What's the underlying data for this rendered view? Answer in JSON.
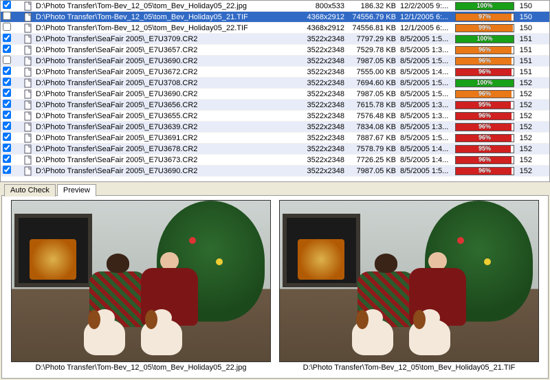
{
  "rows": [
    {
      "checked": true,
      "name": "D:\\Photo Transfer\\Tom-Bev_12_05\\tom_Bev_Holiday05_22.jpg",
      "dim": "800x533",
      "size": "186.32 KB",
      "date": "12/2/2005 9:...",
      "pct": 100,
      "color": "#18a018",
      "grp": "150",
      "alt": false,
      "sel": false
    },
    {
      "checked": false,
      "name": "D:\\Photo Transfer\\Tom-Bev_12_05\\tom_Bev_Holiday05_21.TIF",
      "dim": "4368x2912",
      "size": "74556.79 KB",
      "date": "12/1/2005 6:...",
      "pct": 97,
      "color": "#e87818",
      "grp": "150",
      "alt": true,
      "sel": true
    },
    {
      "checked": false,
      "name": "D:\\Photo Transfer\\Tom-Bev_12_05\\tom_Bev_Holiday05_22.TIF",
      "dim": "4368x2912",
      "size": "74556.81 KB",
      "date": "12/1/2005 6:...",
      "pct": 99,
      "color": "#e87818",
      "grp": "150",
      "alt": false,
      "sel": false
    },
    {
      "checked": true,
      "name": "D:\\Photo Transfer\\SeaFair 2005\\_E7U3709.CR2",
      "dim": "3522x2348",
      "size": "7797.29 KB",
      "date": "8/5/2005 1:5...",
      "pct": 100,
      "color": "#18a018",
      "grp": "151",
      "alt": true,
      "sel": false
    },
    {
      "checked": true,
      "name": "D:\\Photo Transfer\\SeaFair 2005\\_E7U3657.CR2",
      "dim": "3522x2348",
      "size": "7529.78 KB",
      "date": "8/5/2005 1:3...",
      "pct": 96,
      "color": "#e87818",
      "grp": "151",
      "alt": false,
      "sel": false
    },
    {
      "checked": false,
      "name": "D:\\Photo Transfer\\SeaFair 2005\\_E7U3690.CR2",
      "dim": "3522x2348",
      "size": "7987.05 KB",
      "date": "8/5/2005 1:5...",
      "pct": 96,
      "color": "#e87818",
      "grp": "151",
      "alt": true,
      "sel": false
    },
    {
      "checked": true,
      "name": "D:\\Photo Transfer\\SeaFair 2005\\_E7U3672.CR2",
      "dim": "3522x2348",
      "size": "7555.00 KB",
      "date": "8/5/2005 1:4...",
      "pct": 96,
      "color": "#d02020",
      "grp": "151",
      "alt": false,
      "sel": false
    },
    {
      "checked": true,
      "name": "D:\\Photo Transfer\\SeaFair 2005\\_E7U3708.CR2",
      "dim": "3522x2348",
      "size": "7694.60 KB",
      "date": "8/5/2005 1:5...",
      "pct": 100,
      "color": "#18a018",
      "grp": "152",
      "alt": true,
      "sel": false
    },
    {
      "checked": true,
      "name": "D:\\Photo Transfer\\SeaFair 2005\\_E7U3690.CR2",
      "dim": "3522x2348",
      "size": "7987.05 KB",
      "date": "8/5/2005 1:5...",
      "pct": 96,
      "color": "#e87818",
      "grp": "152",
      "alt": false,
      "sel": false
    },
    {
      "checked": true,
      "name": "D:\\Photo Transfer\\SeaFair 2005\\_E7U3656.CR2",
      "dim": "3522x2348",
      "size": "7615.78 KB",
      "date": "8/5/2005 1:3...",
      "pct": 95,
      "color": "#d02020",
      "grp": "152",
      "alt": true,
      "sel": false
    },
    {
      "checked": true,
      "name": "D:\\Photo Transfer\\SeaFair 2005\\_E7U3655.CR2",
      "dim": "3522x2348",
      "size": "7576.48 KB",
      "date": "8/5/2005 1:3...",
      "pct": 96,
      "color": "#d02020",
      "grp": "152",
      "alt": false,
      "sel": false
    },
    {
      "checked": true,
      "name": "D:\\Photo Transfer\\SeaFair 2005\\_E7U3639.CR2",
      "dim": "3522x2348",
      "size": "7834.08 KB",
      "date": "8/5/2005 1:3...",
      "pct": 96,
      "color": "#d02020",
      "grp": "152",
      "alt": true,
      "sel": false
    },
    {
      "checked": true,
      "name": "D:\\Photo Transfer\\SeaFair 2005\\_E7U3691.CR2",
      "dim": "3522x2348",
      "size": "7887.67 KB",
      "date": "8/5/2005 1:5...",
      "pct": 96,
      "color": "#d02020",
      "grp": "152",
      "alt": false,
      "sel": false
    },
    {
      "checked": true,
      "name": "D:\\Photo Transfer\\SeaFair 2005\\_E7U3678.CR2",
      "dim": "3522x2348",
      "size": "7578.79 KB",
      "date": "8/5/2005 1:4...",
      "pct": 95,
      "color": "#d02020",
      "grp": "152",
      "alt": true,
      "sel": false
    },
    {
      "checked": true,
      "name": "D:\\Photo Transfer\\SeaFair 2005\\_E7U3673.CR2",
      "dim": "3522x2348",
      "size": "7726.25 KB",
      "date": "8/5/2005 1:4...",
      "pct": 96,
      "color": "#d02020",
      "grp": "152",
      "alt": false,
      "sel": false
    },
    {
      "checked": true,
      "name": "D:\\Photo Transfer\\SeaFair 2005\\_E7U3690.CR2",
      "dim": "3522x2348",
      "size": "7987.05 KB",
      "date": "8/5/2005 1:5...",
      "pct": 96,
      "color": "#d02020",
      "grp": "152",
      "alt": true,
      "sel": false
    }
  ],
  "tabs": {
    "auto_check": "Auto Check",
    "preview": "Preview"
  },
  "preview": {
    "left_caption": "D:\\Photo Transfer\\Tom-Bev_12_05\\tom_Bev_Holiday05_22.jpg",
    "right_caption": "D:\\Photo Transfer\\Tom-Bev_12_05\\tom_Bev_Holiday05_21.TIF"
  }
}
